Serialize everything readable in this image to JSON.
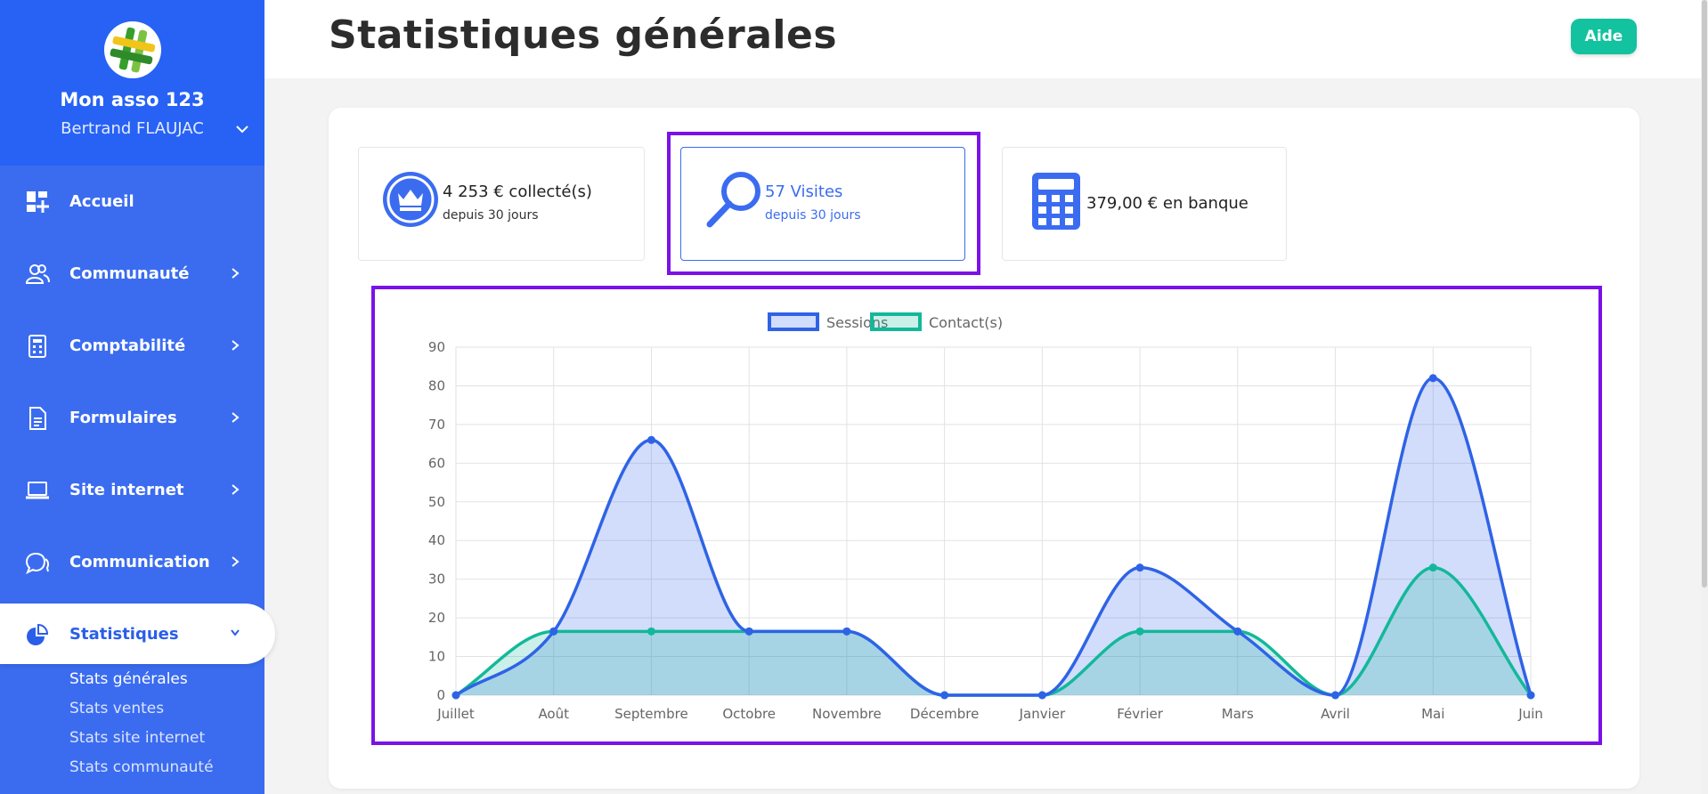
{
  "sidebar": {
    "org_name": "Mon asso 123",
    "user_name": "Bertrand FLAUJAC",
    "items": [
      {
        "label": "Accueil",
        "icon": "dashboard-icon"
      },
      {
        "label": "Communauté",
        "icon": "users-icon"
      },
      {
        "label": "Comptabilité",
        "icon": "calculator-icon"
      },
      {
        "label": "Formulaires",
        "icon": "document-icon"
      },
      {
        "label": "Site internet",
        "icon": "laptop-icon"
      },
      {
        "label": "Communication",
        "icon": "chat-icon"
      },
      {
        "label": "Statistiques",
        "icon": "pie-chart-icon"
      }
    ],
    "active_item": "Statistiques",
    "subitems": [
      "Stats générales",
      "Stats ventes",
      "Stats site internet",
      "Stats communauté"
    ],
    "accent_color": "#3b6cf0"
  },
  "header": {
    "title": "Statistiques générales",
    "help_label": "Aide",
    "help_color": "#13c29e"
  },
  "stats": [
    {
      "main": "4 253 € collecté(s)",
      "sub": "depuis 30 jours",
      "icon": "crown-icon"
    },
    {
      "main": "57 Visites",
      "sub": "depuis 30 jours",
      "icon": "search-icon"
    },
    {
      "main": "379,00 € en banque",
      "sub": "",
      "icon": "calculator-icon"
    }
  ],
  "chart_data": {
    "type": "area",
    "categories": [
      "Juillet",
      "Août",
      "Septembre",
      "Octobre",
      "Novembre",
      "Décembre",
      "Janvier",
      "Février",
      "Mars",
      "Avril",
      "Mai",
      "Juin"
    ],
    "series": [
      {
        "name": "Sessions",
        "values": [
          0,
          16.5,
          66,
          16.5,
          16.5,
          0,
          0,
          33,
          16.5,
          0,
          82,
          0
        ],
        "color": "#2f63e6"
      },
      {
        "name": "Contact(s)",
        "values": [
          0,
          16.5,
          16.5,
          16.5,
          16.5,
          0,
          0,
          16.5,
          16.5,
          0,
          33,
          0
        ],
        "color": "#13b89a"
      }
    ],
    "ylim": [
      0,
      90
    ],
    "yticks": [
      0,
      10,
      20,
      30,
      40,
      50,
      60,
      70,
      80,
      90
    ],
    "grid": true,
    "legend": "top"
  }
}
